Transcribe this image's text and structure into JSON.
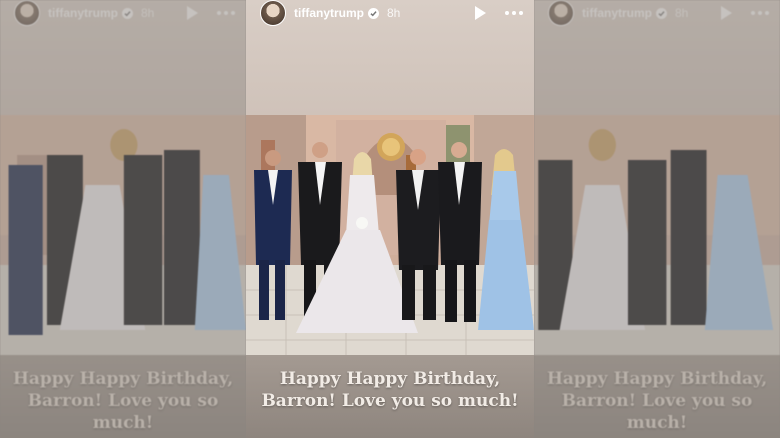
{
  "story": {
    "username": "tiffanytrump",
    "time": "8h",
    "caption": "Happy Happy Birthday, Barron! Love you so much!"
  },
  "icons": {
    "verified": "verified-badge-icon",
    "play": "play-icon",
    "more": "more-options-icon"
  },
  "colors": {
    "caption_text": "#f2ece6",
    "top_background": "#d9cec6",
    "bottom_background": "#8e857e"
  }
}
